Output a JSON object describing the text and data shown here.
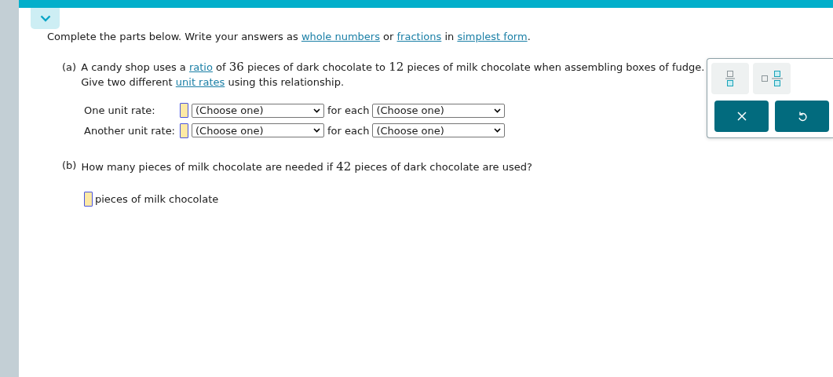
{
  "instructions": [
    {
      "kind": "text",
      "text": "Complete the parts below. Write your answers as "
    },
    {
      "kind": "link",
      "text": "whole numbers"
    },
    {
      "kind": "text",
      "text": " or "
    },
    {
      "kind": "link",
      "text": "fractions"
    },
    {
      "kind": "text",
      "text": " in "
    },
    {
      "kind": "link",
      "text": "simplest form"
    },
    {
      "kind": "text",
      "text": "."
    }
  ],
  "part_a": {
    "label": "(a)",
    "lines": [
      [
        {
          "kind": "text",
          "text": "A candy shop uses a "
        },
        {
          "kind": "link",
          "text": "ratio"
        },
        {
          "kind": "text",
          "text": " of "
        },
        {
          "kind": "number",
          "text": "36"
        },
        {
          "kind": "text",
          "text": " pieces of dark chocolate to "
        },
        {
          "kind": "number",
          "text": "12"
        },
        {
          "kind": "text",
          "text": " pieces of milk chocolate when assembling boxes of fudge."
        }
      ],
      [
        {
          "kind": "text",
          "text": "Give two different "
        },
        {
          "kind": "link",
          "text": "unit rates"
        },
        {
          "kind": "text",
          "text": " using this relationship."
        }
      ]
    ],
    "rows": [
      {
        "label": "One unit rate:",
        "select_1": "(Choose one)",
        "joiner": "for each",
        "select_2": "(Choose one)"
      },
      {
        "label": "Another unit rate:",
        "select_1": "(Choose one)",
        "joiner": "for each",
        "select_2": "(Choose one)"
      }
    ]
  },
  "part_b": {
    "label": "(b)",
    "question": [
      {
        "kind": "text",
        "text": "How many pieces of milk chocolate are needed if "
      },
      {
        "kind": "number",
        "text": "42"
      },
      {
        "kind": "text",
        "text": " pieces of dark chocolate are used?"
      }
    ],
    "answer_suffix": "pieces of milk chocolate"
  },
  "palette": {
    "tools": [
      {
        "kind": "fraction"
      },
      {
        "kind": "mixed"
      }
    ],
    "actions": [
      {
        "kind": "clear"
      },
      {
        "kind": "undo"
      }
    ]
  }
}
